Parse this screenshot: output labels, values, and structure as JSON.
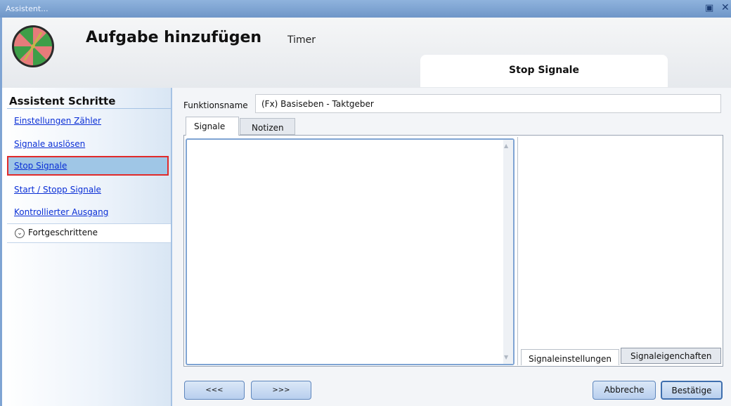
{
  "window": {
    "title": "Assistent...",
    "maximize_icon": "maximize-icon",
    "close_icon": "close-icon"
  },
  "header": {
    "title": "Aufgabe hinzufügen",
    "subtitle": "Timer",
    "current_step": "Stop Signale",
    "logo_icon": "timer-wheel-icon"
  },
  "sidebar": {
    "title": "Assistent Schritte",
    "steps": [
      {
        "label": "Einstellungen Zähler"
      },
      {
        "label": "Signale auslösen"
      },
      {
        "label": "Stop Signale",
        "active": true
      },
      {
        "label": "Start / Stopp Signale"
      },
      {
        "label": "Kontrollierter Ausgang"
      }
    ],
    "advanced": {
      "label": "Fortgeschrittene",
      "icon": "chevron-down-circle-icon"
    }
  },
  "form": {
    "function_name_label": "Funktionsname",
    "function_name_value": "(Fx) Basiseben - Taktgeber"
  },
  "tabs": [
    {
      "label": "Signale",
      "selected": true
    },
    {
      "label": "Notizen",
      "selected": false
    }
  ],
  "property_tabs": [
    {
      "label": "Signaleinstellungen",
      "selected": true
    },
    {
      "label": "Signaleigenchaften",
      "selected": false
    }
  ],
  "footer": {
    "prev_label": "<<<",
    "next_label": ">>>",
    "cancel_label": "Abbreche",
    "confirm_label": "Bestätige"
  },
  "colors": {
    "accent_blue": "#7fa4d3",
    "active_step_bg": "#9fc6e6",
    "active_step_border": "#e12a2a",
    "link": "#0a2fd6"
  }
}
